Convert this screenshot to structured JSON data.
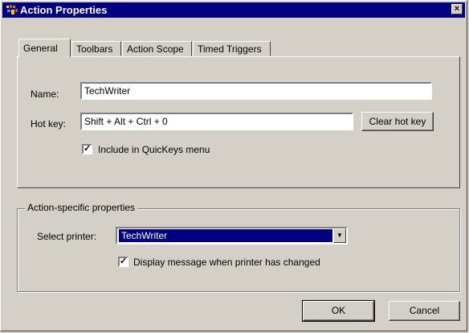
{
  "window": {
    "title": "Action Properties",
    "close_glyph": "×"
  },
  "tabs": [
    {
      "label": "General",
      "active": true
    },
    {
      "label": "Toolbars",
      "active": false
    },
    {
      "label": "Action Scope",
      "active": false
    },
    {
      "label": "Timed Triggers",
      "active": false
    }
  ],
  "general": {
    "name_label": "Name:",
    "name_value": "TechWriter",
    "hotkey_label": "Hot key:",
    "hotkey_value": "Shift + Alt + Ctrl + 0",
    "clear_hotkey_label": "Clear hot key",
    "include_quickkeys_label": "Include in QuicKeys menu",
    "include_quickkeys_checked": true
  },
  "action_specific": {
    "group_title": "Action-specific properties",
    "select_printer_label": "Select printer:",
    "select_printer_value": "TechWriter",
    "display_message_label": "Display message when printer has changed",
    "display_message_checked": true
  },
  "buttons": {
    "ok_label": "OK",
    "cancel_label": "Cancel"
  },
  "colors": {
    "titlebar": "#000080",
    "face": "#d4d0c8",
    "selection": "#000080"
  }
}
